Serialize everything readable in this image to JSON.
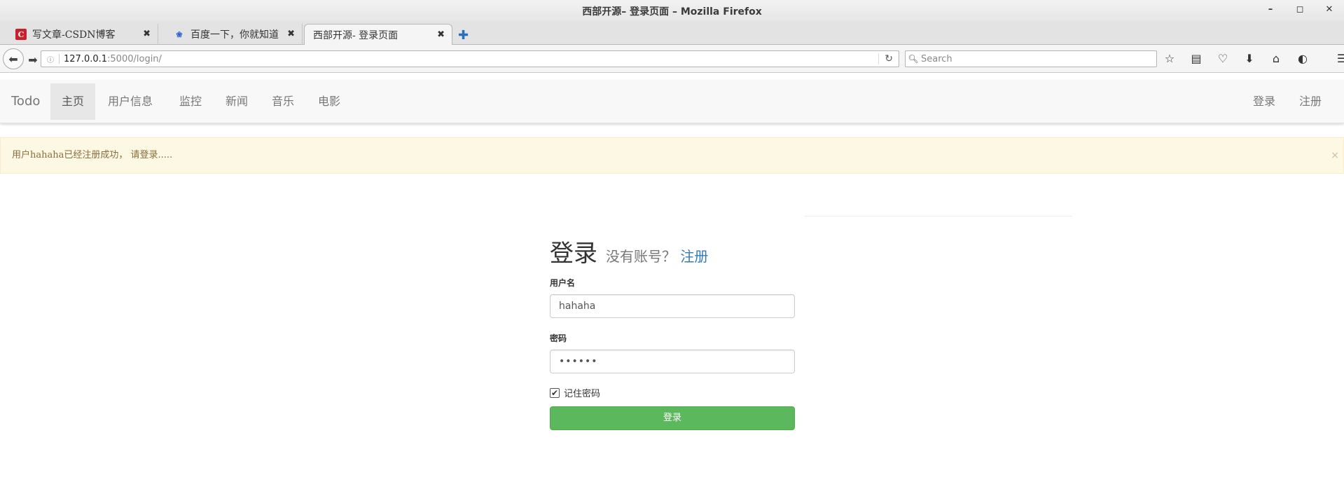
{
  "window": {
    "title": "西部开源– 登录页面 – Mozilla Firefox",
    "min_icon": "minimize-icon",
    "max_icon": "maximize-icon",
    "close_icon": "close-icon"
  },
  "tabs": [
    {
      "label": "写文章-CSDN博客",
      "favicon": "C"
    },
    {
      "label": "百度一下，你就知道",
      "favicon": "❀"
    },
    {
      "label": "西部开源- 登录页面",
      "favicon": ""
    }
  ],
  "url": {
    "host": "127.0.0.1",
    "path": ":5000/login/"
  },
  "search": {
    "placeholder": "Search"
  },
  "app": {
    "brand": "Todo",
    "nav": [
      "主页",
      "用户信息",
      "监控",
      "新闻",
      "音乐",
      "电影"
    ],
    "right_nav": [
      "登录",
      "注册"
    ]
  },
  "alert": {
    "message": "用户hahaha已经注册成功， 请登录.....",
    "close": "×"
  },
  "login": {
    "title": "登录",
    "subtitle": "没有账号？",
    "register_link": "注册",
    "username_label": "用户名",
    "username_value": "hahaha",
    "password_label": "密码",
    "password_value": "••••••",
    "remember_label": "记住密码",
    "remember_checked": true,
    "submit_label": "登录"
  },
  "colors": {
    "accent": "#337ab7",
    "success": "#5cb85c",
    "alert_bg": "#fcf8e3",
    "alert_text": "#8a6d3b"
  }
}
